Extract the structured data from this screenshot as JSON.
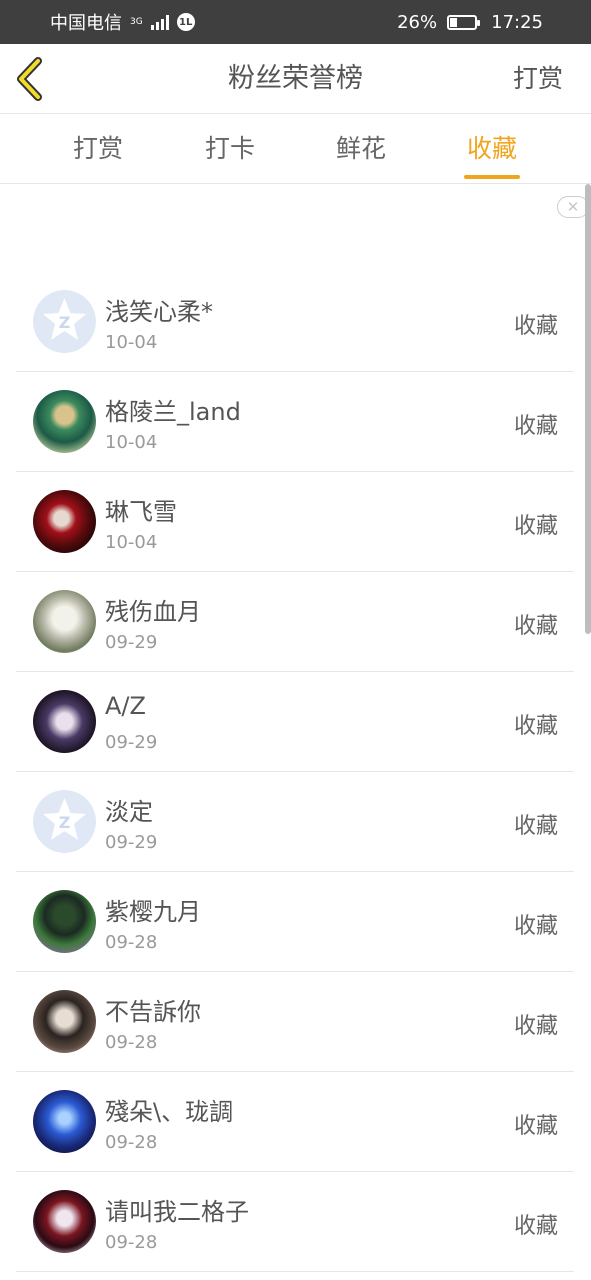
{
  "status": {
    "carrier": "中国电信",
    "network": "3G",
    "badge": "1L",
    "battery": "26%",
    "battery_fraction": 0.26,
    "time": "17:25"
  },
  "header": {
    "title": "粉丝荣誉榜",
    "right_button": "打赏",
    "back_icon": "chevron-left-icon",
    "accent": "#f0a51f"
  },
  "tabs": [
    {
      "label": "打赏",
      "active": false
    },
    {
      "label": "打卡",
      "active": false
    },
    {
      "label": "鲜花",
      "active": false
    },
    {
      "label": "收藏",
      "active": true
    }
  ],
  "fans": [
    {
      "name": "浅笑心柔*",
      "date": "10-04",
      "action": "收藏",
      "avatar": "default"
    },
    {
      "name": "格陵兰_land",
      "date": "10-04",
      "action": "收藏",
      "avatar": "photo"
    },
    {
      "name": "琳飞雪",
      "date": "10-04",
      "action": "收藏",
      "avatar": "photo"
    },
    {
      "name": "残伤血月",
      "date": "09-29",
      "action": "收藏",
      "avatar": "photo"
    },
    {
      "name": "A/Z",
      "date": "09-29",
      "action": "收藏",
      "avatar": "photo"
    },
    {
      "name": "淡定",
      "date": "09-29",
      "action": "收藏",
      "avatar": "default"
    },
    {
      "name": "紫樱九月",
      "date": "09-28",
      "action": "收藏",
      "avatar": "photo"
    },
    {
      "name": "不告訴你",
      "date": "09-28",
      "action": "收藏",
      "avatar": "photo"
    },
    {
      "name": "殘朵\\、珑調",
      "date": "09-28",
      "action": "收藏",
      "avatar": "photo"
    },
    {
      "name": "请叫我二格子",
      "date": "09-28",
      "action": "收藏",
      "avatar": "photo"
    }
  ]
}
